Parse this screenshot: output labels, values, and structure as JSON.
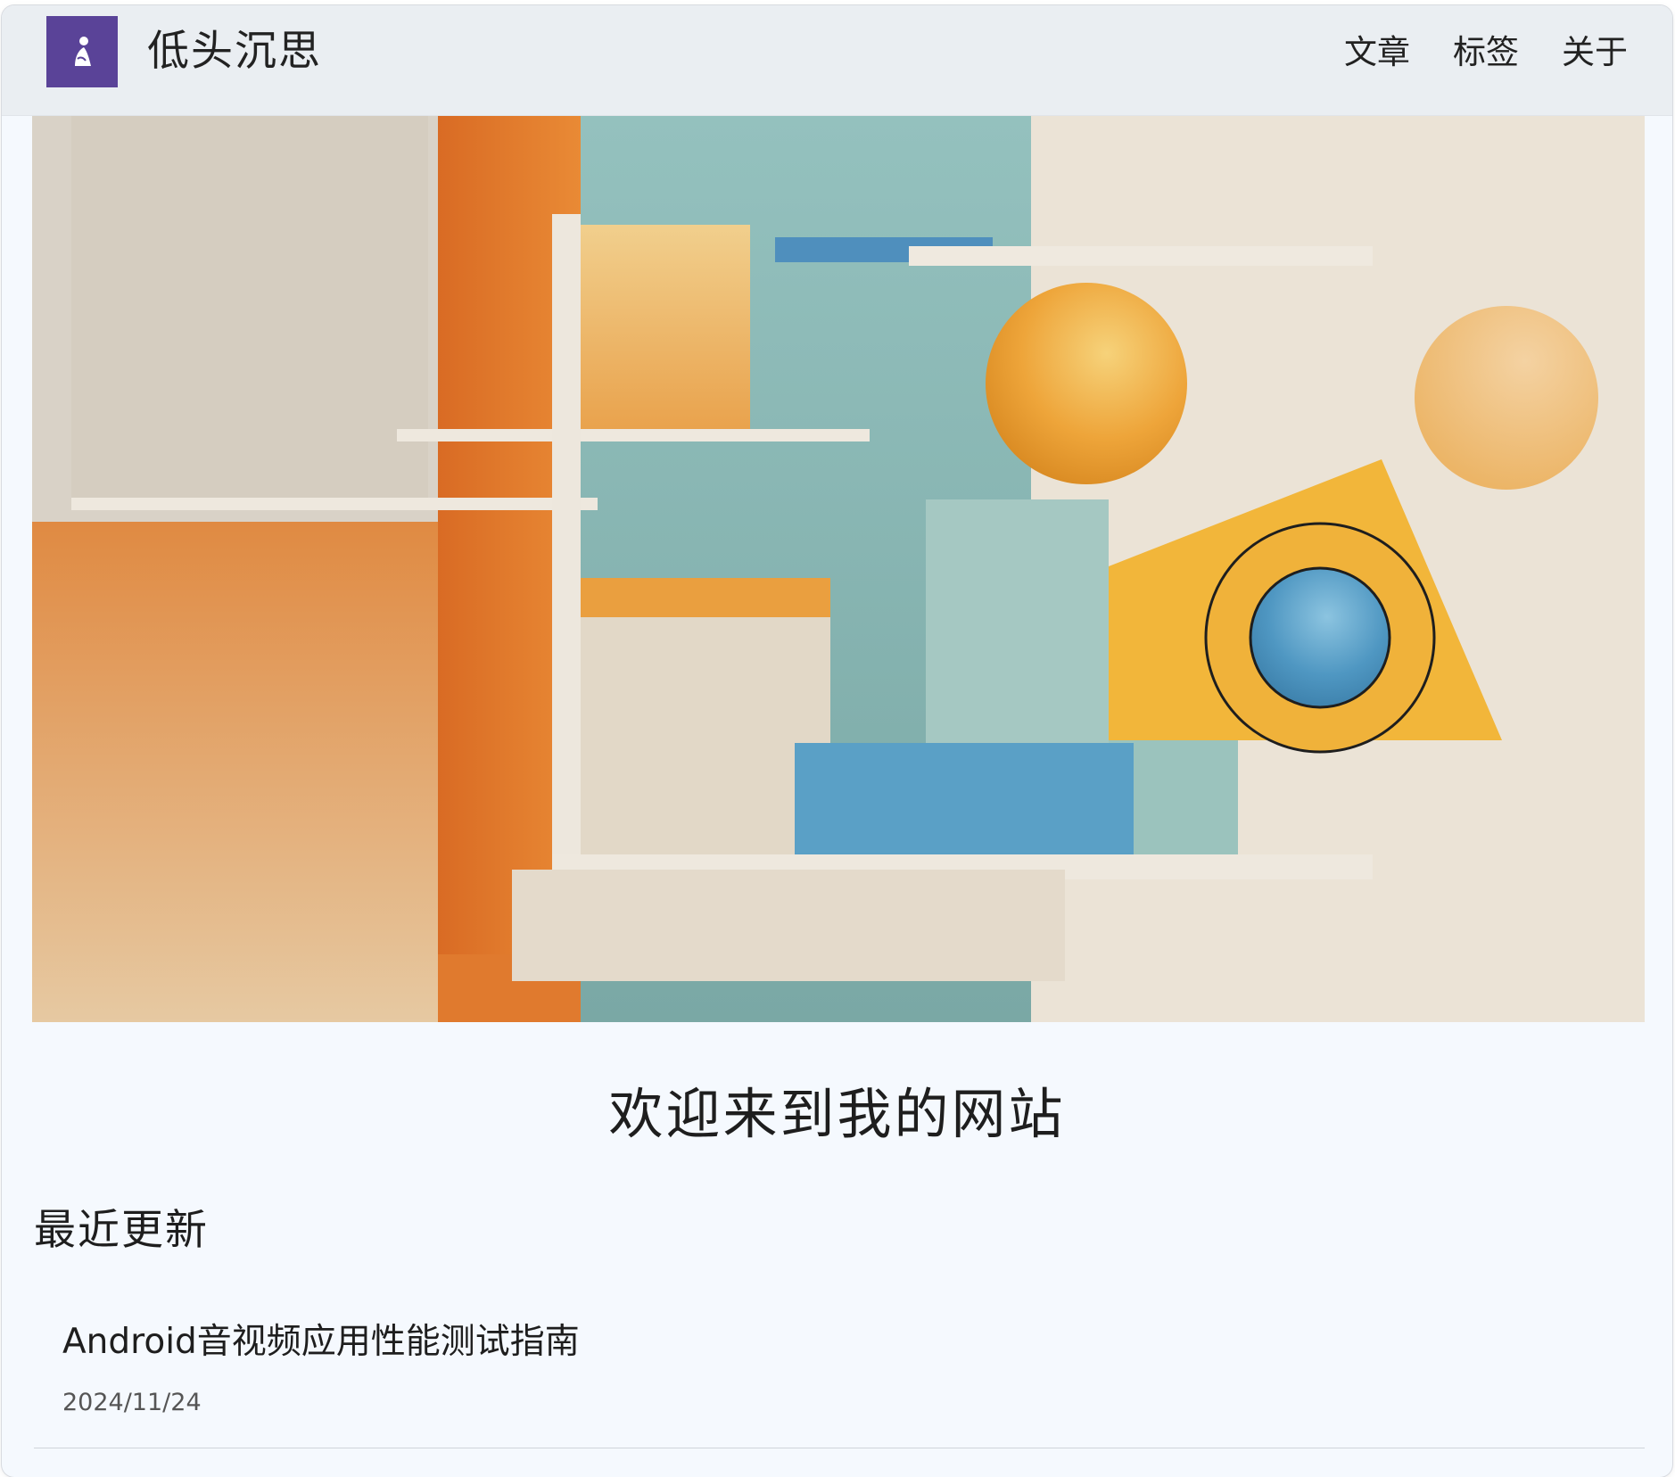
{
  "header": {
    "logo_icon": "person-icon",
    "site_title": "低头沉思",
    "nav": [
      {
        "label": "文章"
      },
      {
        "label": "标签"
      },
      {
        "label": "关于"
      }
    ]
  },
  "hero": {
    "image": "abstract-geometric-shapes-illustration"
  },
  "main": {
    "welcome": "欢迎来到我的网站",
    "recent_title": "最近更新",
    "posts": [
      {
        "title": "Android音视频应用性能测试指南",
        "date": "2024/11/24"
      }
    ]
  },
  "colors": {
    "logo_bg": "#5a4398",
    "header_bg": "#eaeef2",
    "page_bg": "#f5f9fe"
  }
}
